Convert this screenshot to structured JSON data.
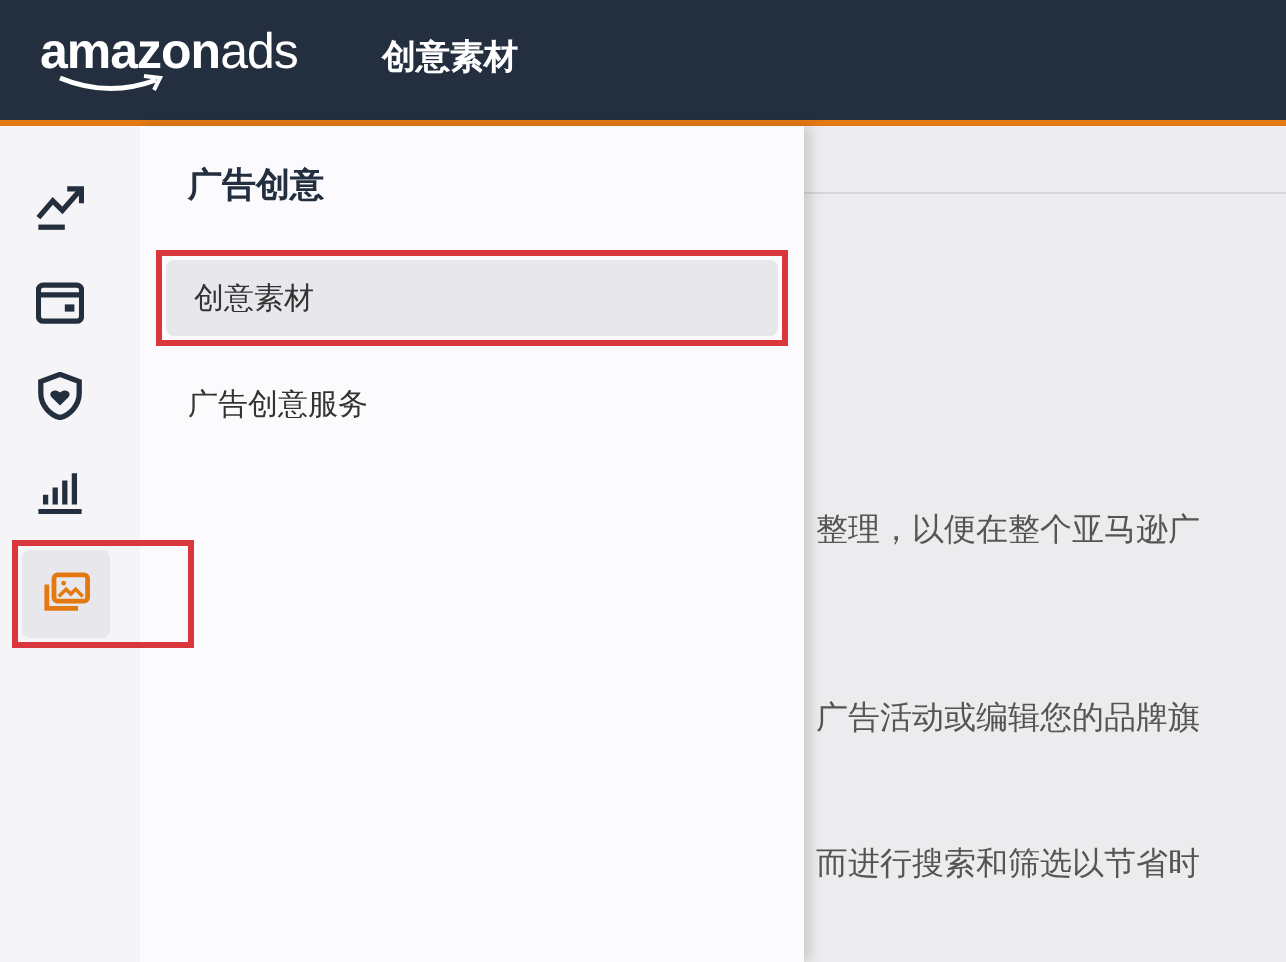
{
  "header": {
    "logo": "**amazon**ads",
    "title": "创意素材"
  },
  "rail": [
    {
      "kind": "trend",
      "selected": false,
      "annotated": false
    },
    {
      "kind": "card",
      "selected": false,
      "annotated": false
    },
    {
      "kind": "shield",
      "selected": false,
      "annotated": false
    },
    {
      "kind": "bars",
      "selected": false,
      "annotated": false
    },
    {
      "kind": "images",
      "selected": true,
      "annotated": true
    }
  ],
  "flyout": {
    "heading": "广告创意",
    "items": [
      {
        "label": "创意素材",
        "selected": true,
        "annotated": true
      },
      {
        "label": "广告创意服务",
        "selected": false,
        "annotated": false
      }
    ]
  },
  "content_lines": [
    "整理，以便在整个亚马逊广",
    "广告活动或编辑您的品牌旗",
    "而进行搜索和筛选以节省时"
  ]
}
